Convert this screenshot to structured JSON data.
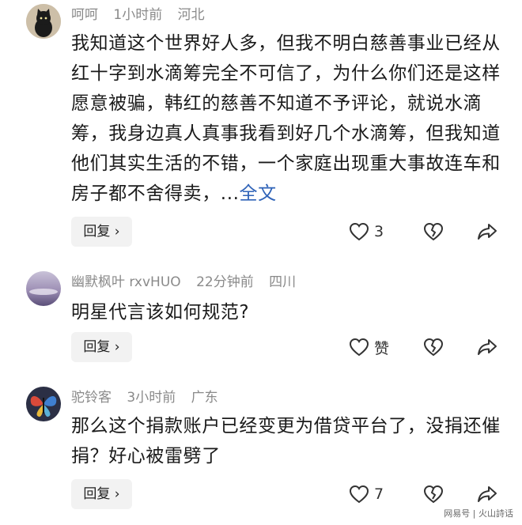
{
  "comments": [
    {
      "username": "呵呵",
      "time": "1小时前",
      "location": "河北",
      "text": "我知道这个世界好人多，但我不明白慈善事业已经从红十字到水滴筹完全不可信了，为什么你们还是这样愿意被骗，韩红的慈善不知道不予评论，就说水滴筹，我身边真人真事我看到好几个水滴筹，但我知道他们其实生活的不错，一个家庭出现重大事故连车和房子都不舍得卖，...",
      "full_text_link": "全文",
      "reply_label": "回复 ›",
      "like_count": "3"
    },
    {
      "username": "幽默枫叶 rxvHUO",
      "time": "22分钟前",
      "location": "四川",
      "text": "明星代言该如何规范?",
      "reply_label": "回复 ›",
      "like_count": "赞"
    },
    {
      "username": "驼铃客",
      "time": "3小时前",
      "location": "广东",
      "text": "那么这个捐款账户已经变更为借贷平台了，没捐还催捐？好心被雷劈了",
      "reply_label": "回复 ›",
      "like_count": "7"
    }
  ],
  "watermark": "网易号 | 火山詩话",
  "icons": [
    "heart-icon",
    "broken-heart-icon",
    "share-icon"
  ]
}
